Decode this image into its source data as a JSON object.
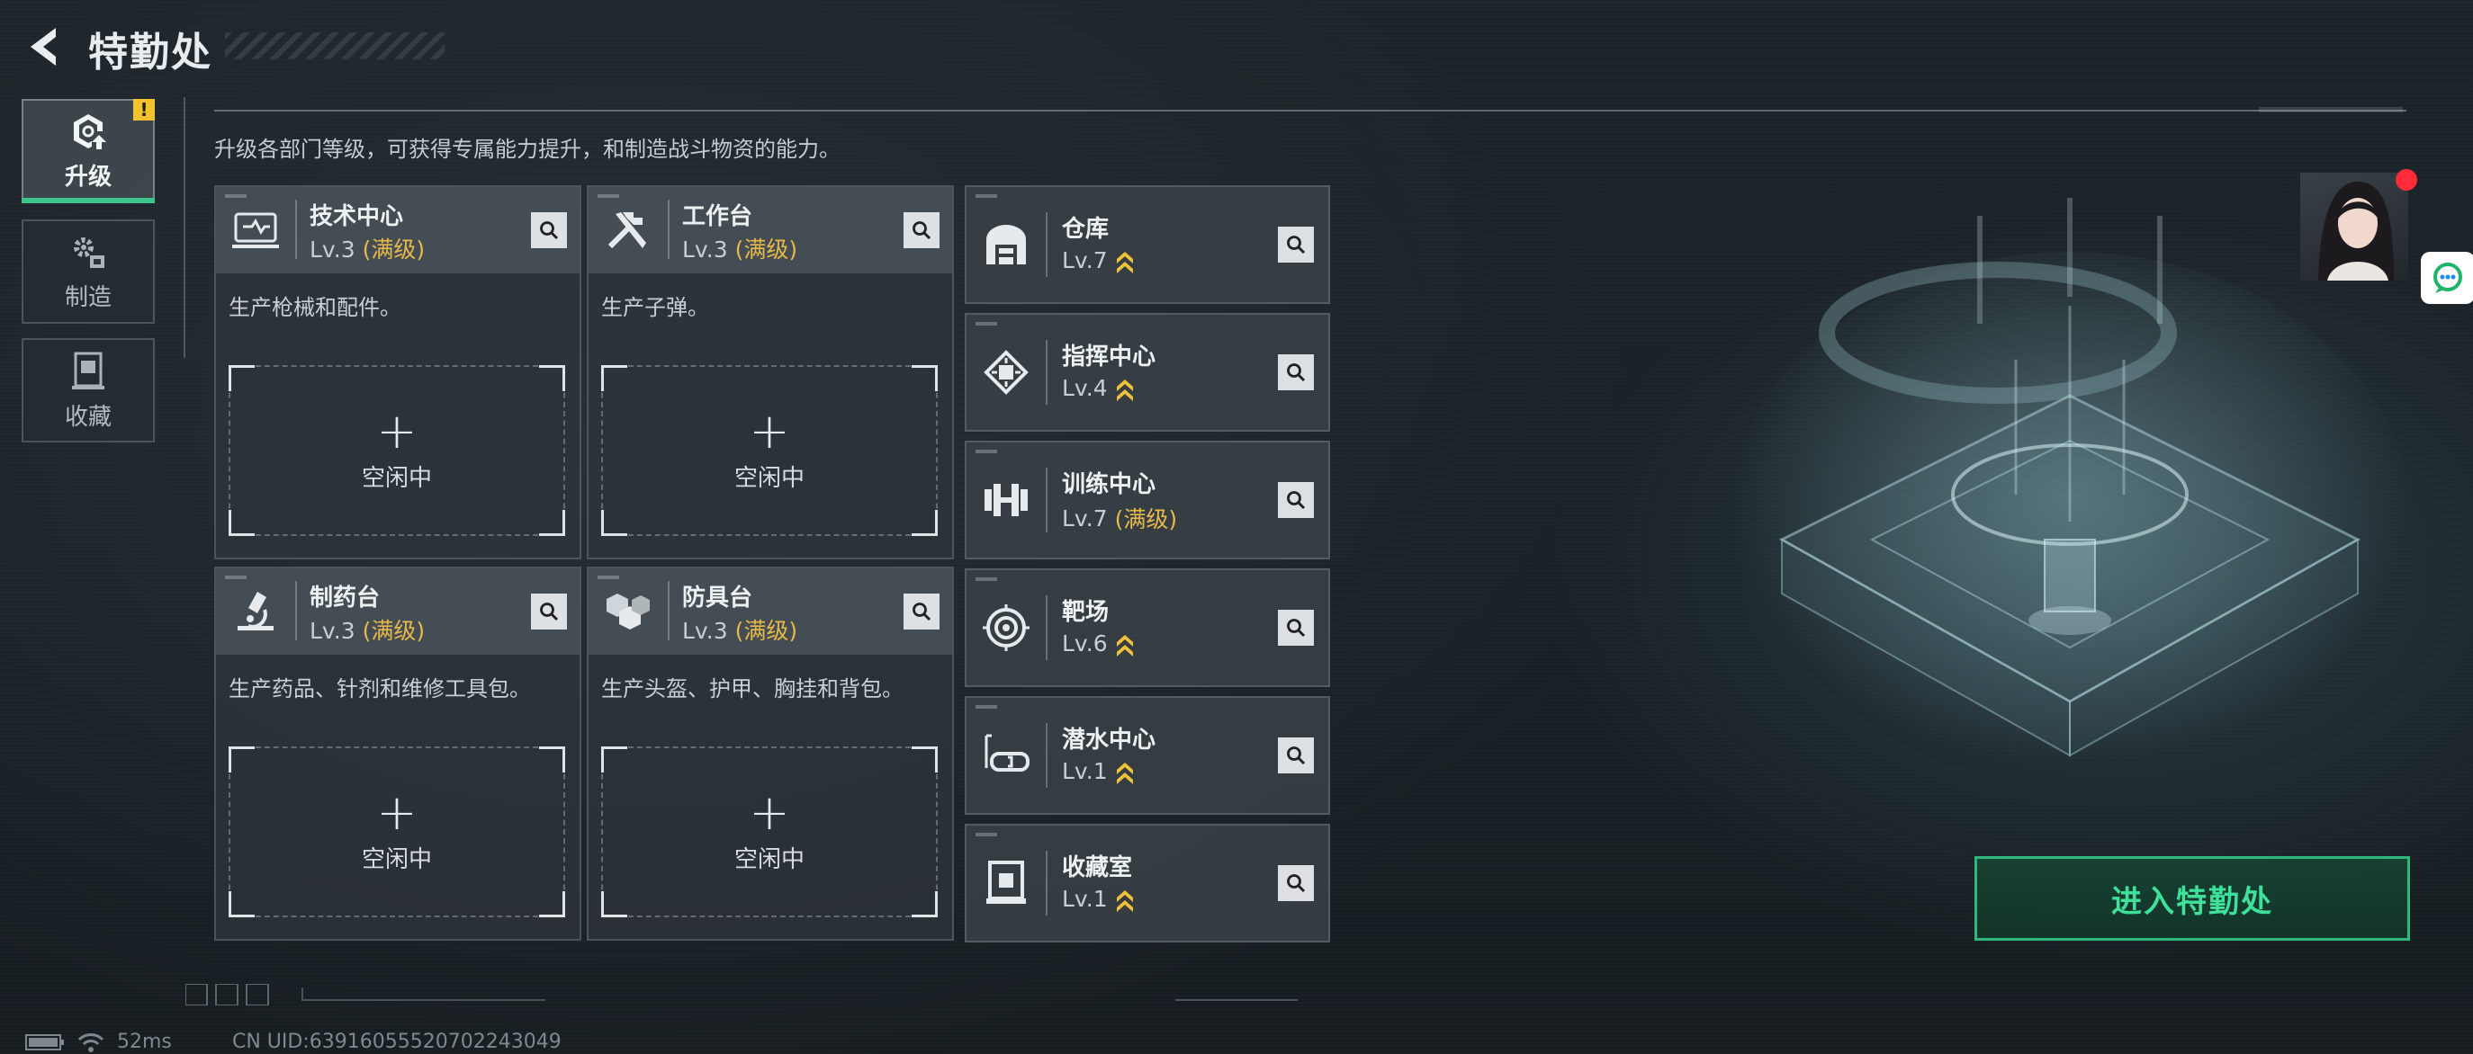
{
  "header": {
    "title": "特勤处"
  },
  "tabs": [
    {
      "label": "升级",
      "icon": "upgrade-icon",
      "active": true,
      "badge": "!"
    },
    {
      "label": "制造",
      "icon": "gears-icon",
      "active": false
    },
    {
      "label": "收藏",
      "icon": "collection-icon",
      "active": false
    }
  ],
  "description": "升级各部门等级，可获得专属能力提升，和制造战斗物资的能力。",
  "stations": [
    {
      "name": "技术中心",
      "level": "Lv.3",
      "max": "(满级)",
      "desc": "生产枪械和配件。",
      "slot_label": "空闲中",
      "icon": "workbench-monitor-icon"
    },
    {
      "name": "工作台",
      "level": "Lv.3",
      "max": "(满级)",
      "desc": "生产子弹。",
      "slot_label": "空闲中",
      "icon": "tools-icon"
    },
    {
      "name": "制药台",
      "level": "Lv.3",
      "max": "(满级)",
      "desc": "生产药品、针剂和维修工具包。",
      "slot_label": "空闲中",
      "icon": "microscope-icon"
    },
    {
      "name": "防具台",
      "level": "Lv.3",
      "max": "(满级)",
      "desc": "生产头盔、护甲、胸挂和背包。",
      "slot_label": "空闲中",
      "icon": "armor-blocks-icon"
    }
  ],
  "facilities": [
    {
      "name": "仓库",
      "level": "Lv.7",
      "max": null,
      "upgradable": true,
      "icon": "warehouse-icon"
    },
    {
      "name": "指挥中心",
      "level": "Lv.4",
      "max": null,
      "upgradable": true,
      "icon": "command-chip-icon"
    },
    {
      "name": "训练中心",
      "level": "Lv.7",
      "max": "(满级)",
      "upgradable": false,
      "icon": "dumbbell-icon"
    },
    {
      "name": "靶场",
      "level": "Lv.6",
      "max": null,
      "upgradable": true,
      "icon": "target-icon"
    },
    {
      "name": "潜水中心",
      "level": "Lv.1",
      "max": null,
      "upgradable": true,
      "icon": "diving-mask-icon"
    },
    {
      "name": "收藏室",
      "level": "Lv.1",
      "max": null,
      "upgradable": true,
      "icon": "display-case-icon"
    }
  ],
  "enter_button": "进入特勤处",
  "status": {
    "ping": "52ms",
    "uid": "CN UID:6391605552070224304​9"
  },
  "colors": {
    "accent_green": "#3ec38a",
    "max_level": "#e7b94a",
    "upgrade_chevron": "#f0c23a",
    "badge": "#f2c230",
    "notify_dot": "#ff2a3a"
  }
}
